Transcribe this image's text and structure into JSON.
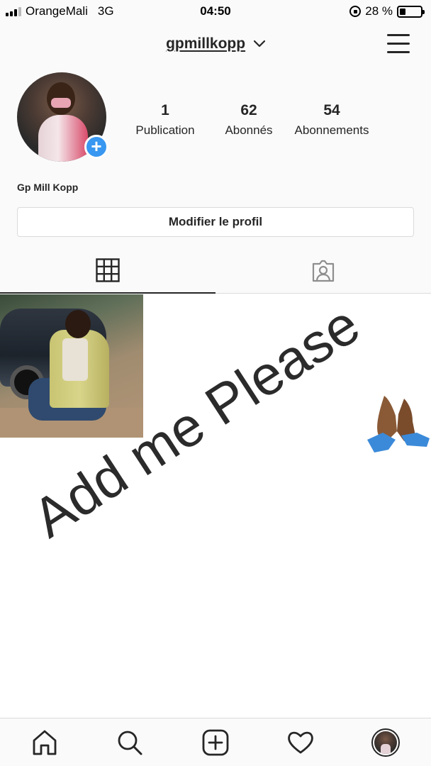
{
  "status_bar": {
    "carrier": "OrangeMali",
    "network": "3G",
    "time": "04:50",
    "battery": "28 %",
    "battery_level": 0.28,
    "icons": [
      "signal-icon",
      "rotation-lock-icon",
      "battery-icon"
    ]
  },
  "header": {
    "username": "gpmillkopp",
    "icons": [
      "chevron-down-icon",
      "menu-icon"
    ]
  },
  "profile": {
    "display_name": "Gp Mill Kopp",
    "stats": [
      {
        "value": "1",
        "label": "Publication"
      },
      {
        "value": "62",
        "label": "Abonnés"
      },
      {
        "value": "54",
        "label": "Abonnements"
      }
    ],
    "edit_button": "Modifier le profil",
    "add_badge_icon": "plus-icon"
  },
  "tabs": {
    "items": [
      {
        "icon": "grid-icon",
        "active": true
      },
      {
        "icon": "tagged-icon",
        "active": false
      }
    ]
  },
  "overlay": {
    "text": "Add me Please",
    "emoji": "folded-hands-icon"
  },
  "bottom_nav": {
    "items": [
      "home-icon",
      "search-icon",
      "add-post-icon",
      "heart-icon",
      "profile-avatar"
    ]
  },
  "colors": {
    "accent": "#3897f0",
    "text": "#262626",
    "border": "#dbdbdb",
    "background": "#fafafa"
  }
}
